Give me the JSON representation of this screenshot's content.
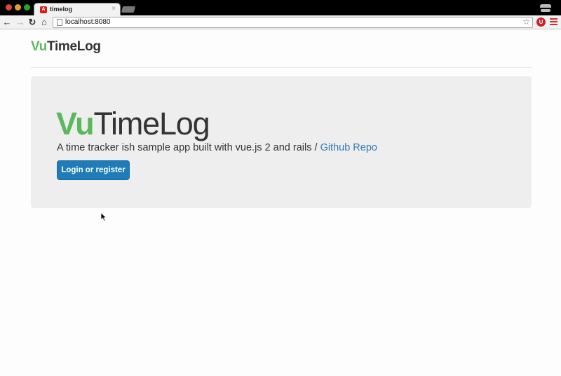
{
  "browser": {
    "tab_title": "timelog",
    "tab_favicon_letter": "A",
    "tab_close": "×",
    "url": "localhost:8080",
    "ext_icon_letter": "U"
  },
  "nav": {
    "brand_prefix": "Vu",
    "brand_suffix": "TimeLog"
  },
  "hero": {
    "title_prefix": "Vu",
    "title_suffix": "TimeLog",
    "lead_text": "A time tracker ish sample app built with vue.js 2 and rails / ",
    "repo_link": "Github Repo",
    "login_button": "Login or register"
  },
  "colors": {
    "brand_green": "#5cb85c",
    "primary_blue": "#1e7cb8",
    "link_blue": "#337ab7",
    "jumbotron_bg": "#eeeeee"
  }
}
